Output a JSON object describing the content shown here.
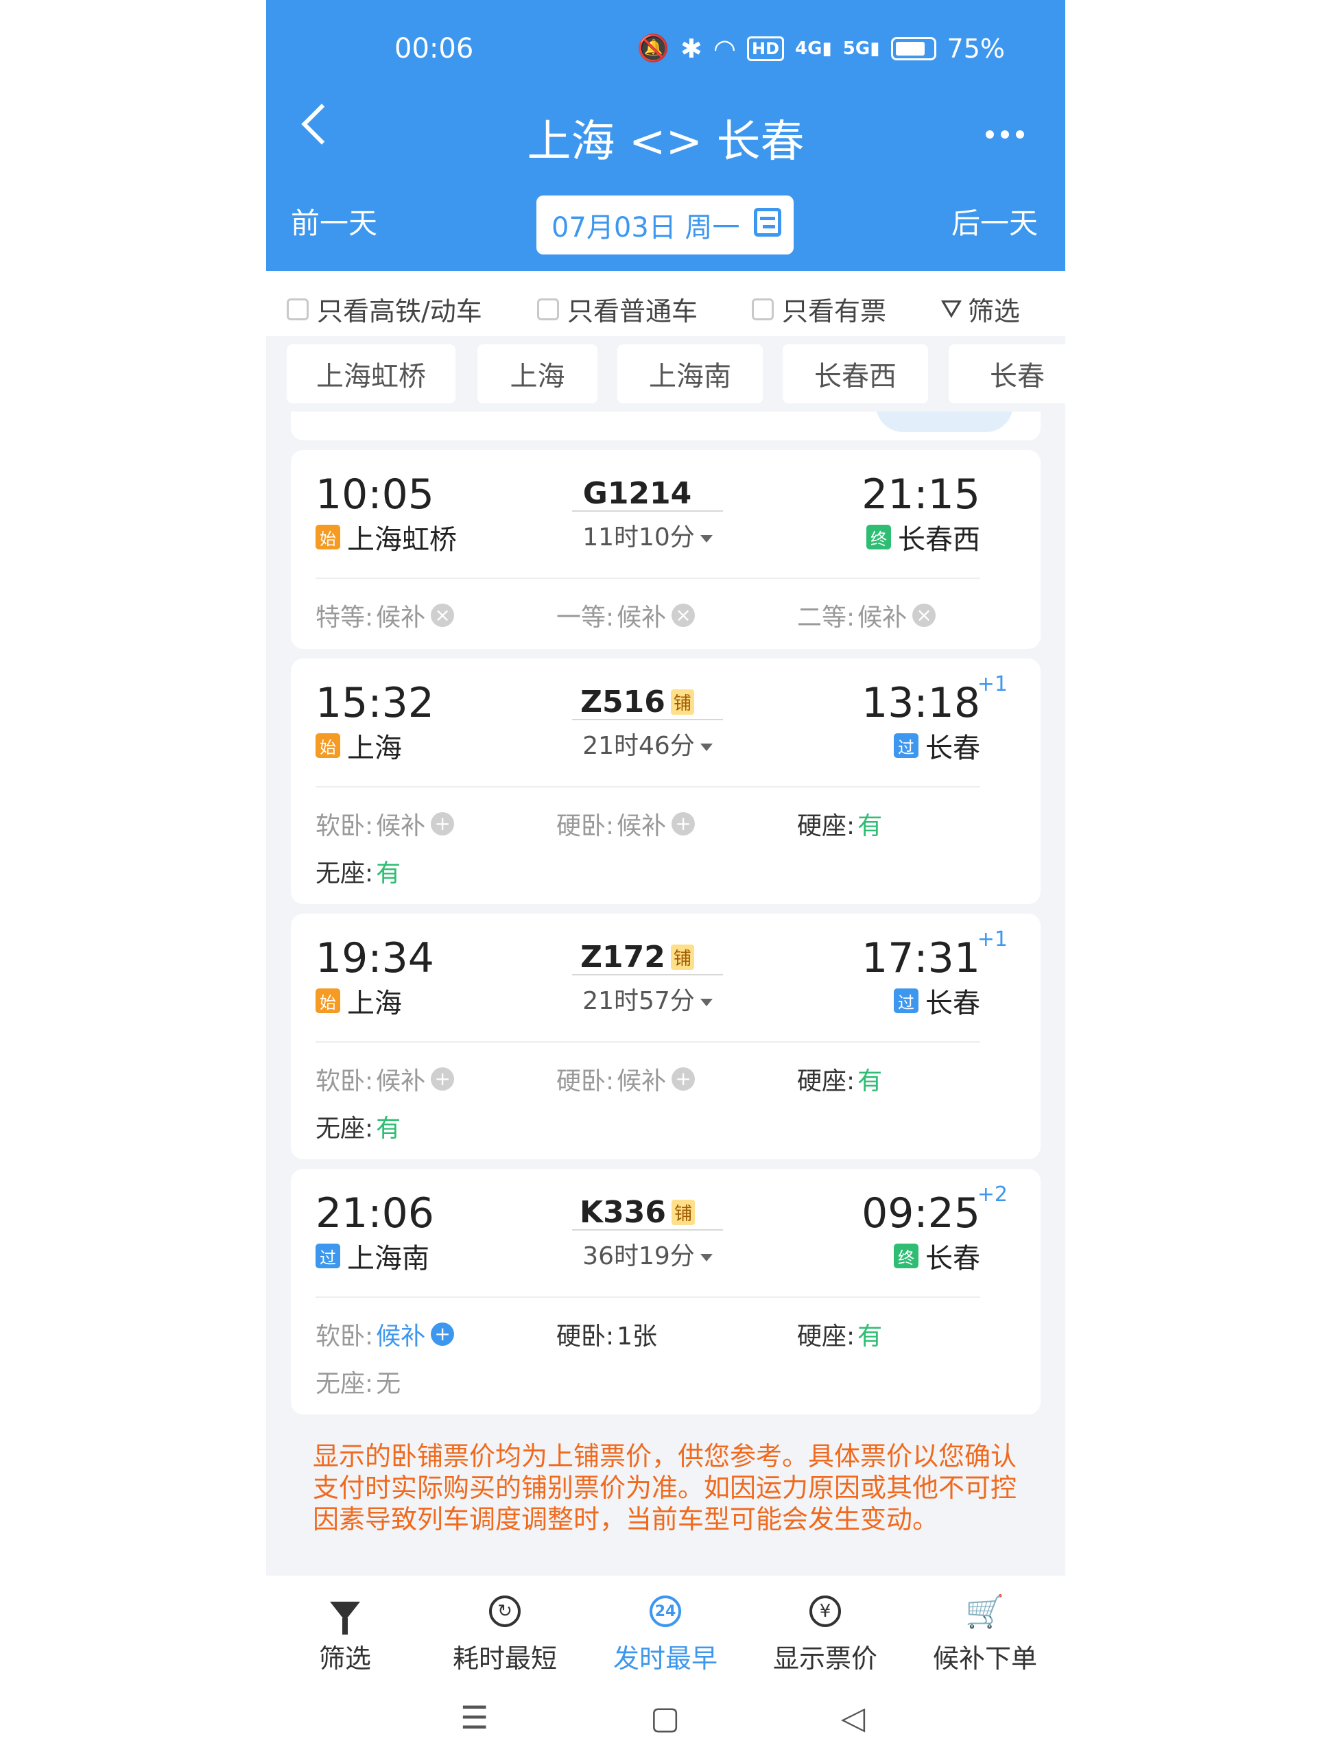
{
  "status_bar": {
    "time": "00:06",
    "battery": "75%"
  },
  "header": {
    "title": "上海 <> 长春",
    "prev_day": "前一天",
    "next_day": "后一天",
    "date": "07月03日 周一"
  },
  "filters": {
    "hsr_only": "只看高铁/动车",
    "normal_only": "只看普通车",
    "available_only": "只看有票",
    "filter": "筛选"
  },
  "stations": [
    "上海虹桥",
    "上海",
    "上海南",
    "长春西",
    "长春"
  ],
  "trains": [
    {
      "number": "G1214",
      "berth_tag": "",
      "depart": "10:05",
      "depart_tag": "始",
      "depart_station": "上海虹桥",
      "duration": "11时10分",
      "arrive": "21:15",
      "arrive_plus": "",
      "arrive_tag": "终",
      "arrive_station": "长春西",
      "seats": [
        {
          "label": "特等:",
          "value": "候补"
        },
        {
          "label": "一等:",
          "value": "候补"
        },
        {
          "label": "二等:",
          "value": "候补"
        }
      ]
    },
    {
      "number": "Z516",
      "berth_tag": "铺",
      "depart": "15:32",
      "depart_tag": "始",
      "depart_station": "上海",
      "duration": "21时46分",
      "arrive": "13:18",
      "arrive_plus": "+1",
      "arrive_tag": "过",
      "arrive_station": "长春",
      "seats": [
        {
          "label": "软卧:",
          "value": "候补"
        },
        {
          "label": "硬卧:",
          "value": "候补"
        },
        {
          "label": "硬座:",
          "value": "有"
        },
        {
          "label": "无座:",
          "value": "有"
        }
      ]
    },
    {
      "number": "Z172",
      "berth_tag": "铺",
      "depart": "19:34",
      "depart_tag": "始",
      "depart_station": "上海",
      "duration": "21时57分",
      "arrive": "17:31",
      "arrive_plus": "+1",
      "arrive_tag": "过",
      "arrive_station": "长春",
      "seats": [
        {
          "label": "软卧:",
          "value": "候补"
        },
        {
          "label": "硬卧:",
          "value": "候补"
        },
        {
          "label": "硬座:",
          "value": "有"
        },
        {
          "label": "无座:",
          "value": "有"
        }
      ]
    },
    {
      "number": "K336",
      "berth_tag": "铺",
      "depart": "21:06",
      "depart_tag": "过",
      "depart_station": "上海南",
      "duration": "36时19分",
      "arrive": "09:25",
      "arrive_plus": "+2",
      "arrive_tag": "终",
      "arrive_station": "长春",
      "seats": [
        {
          "label": "软卧:",
          "value": "候补"
        },
        {
          "label": "硬卧:",
          "value": "1张"
        },
        {
          "label": "硬座:",
          "value": "有"
        },
        {
          "label": "无座:",
          "value": "无"
        }
      ]
    }
  ],
  "notice": "显示的卧铺票价均为上铺票价，供您参考。具体票价以您确认支付时实际购买的铺别票价为准。如因运力原因或其他不可控因素导致列车调度调整时，当前车型可能会发生变动。",
  "tabbar": {
    "filter": "筛选",
    "shortest": "耗时最短",
    "earliest": "发时最早",
    "earliest_icon_text": "24",
    "show_price": "显示票价",
    "waitlist": "候补下单"
  },
  "colors": {
    "primary": "#3d97ee",
    "available": "#2ebd73",
    "notice": "#f06a1e",
    "start_tag": "#f59a23"
  }
}
